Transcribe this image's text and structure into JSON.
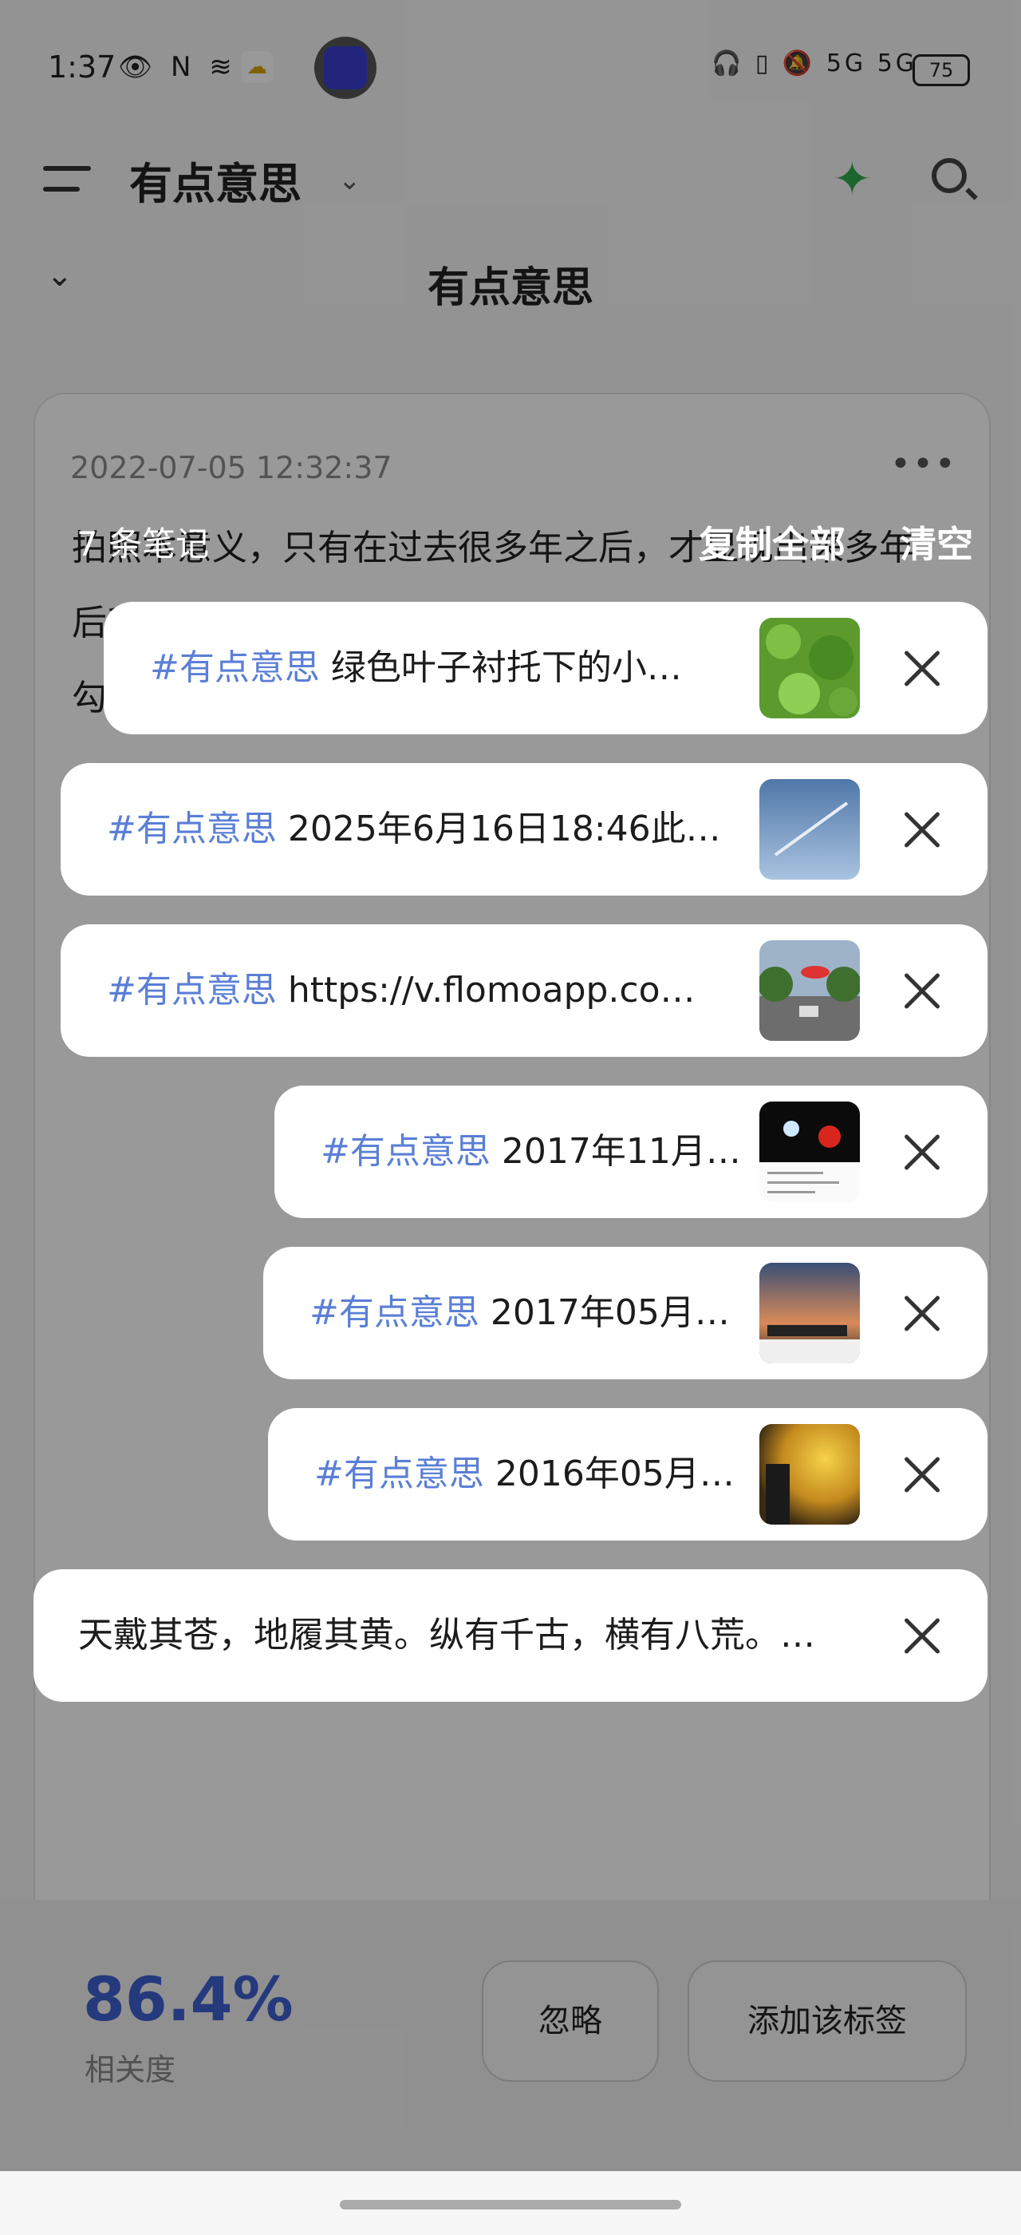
{
  "status_bar": {
    "time": "1:37",
    "left_icons": "👁 N ≋",
    "right_icons": "🎧 ▯ 🔕 5G 5G",
    "battery": "75"
  },
  "header": {
    "title": "有点意思",
    "tag_title": "有点意思"
  },
  "memo": {
    "date": "2022-07-05 12:32:37",
    "more_label": "•••",
    "body": "拍照本意义，只有在过去很多年之后，才显现出来多年后我依然难忘这个画面的光影，每次看到都忍不住点一勾勒出时光的画卷"
  },
  "clipboard": {
    "count_label": "7 条笔记",
    "copy_all": "复制全部",
    "clear": "清空",
    "items": [
      {
        "tag": "#有点意思",
        "text": " 绿色叶子衬托下的小…",
        "thumb": "leaves"
      },
      {
        "tag": "#有点意思",
        "text": " 2025年6月16日18:46此…",
        "thumb": "sky"
      },
      {
        "tag": "#有点意思",
        "text": " https://v.flomoapp.co…",
        "thumb": "street"
      },
      {
        "tag": "#有点意思",
        "text": " 2017年11月…",
        "thumb": "night"
      },
      {
        "tag": "#有点意思",
        "text": " 2017年05月…",
        "thumb": "dusk"
      },
      {
        "tag": "#有点意思",
        "text": " 2016年05月…",
        "thumb": "sunset"
      },
      {
        "tag": "",
        "text": "天戴其苍，地履其黄。纵有千古，横有八荒。…",
        "thumb": ""
      }
    ]
  },
  "relevance": {
    "score": "86.4%",
    "label": "相关度",
    "ignore_label": "忽略",
    "add_tag_label": "添加该标签"
  },
  "colors": {
    "tag_blue": "#5b7fd6",
    "score_blue": "#3f5fd0",
    "sparkle_green": "#2fa84f"
  }
}
